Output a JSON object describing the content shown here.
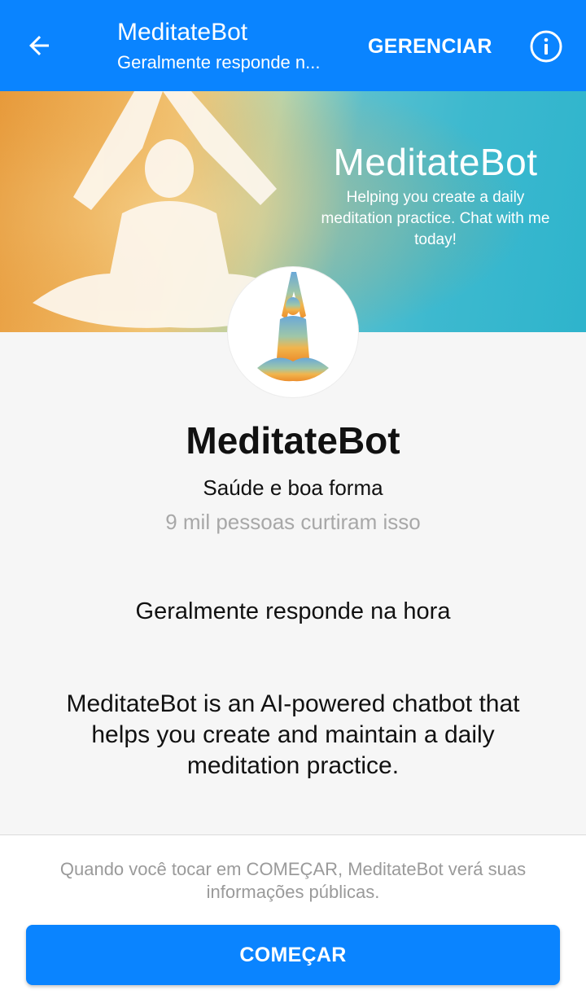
{
  "header": {
    "title": "MeditateBot",
    "subtitle": "Geralmente responde n...",
    "manage_label": "GERENCIAR",
    "back_icon": "arrow-left-icon",
    "info_icon": "info-icon"
  },
  "banner": {
    "title": "MeditateBot",
    "tagline": "Helping you create a daily meditation practice. Chat with me today!"
  },
  "profile": {
    "name": "MeditateBot",
    "category": "Saúde e boa forma",
    "likes": "9 mil pessoas curtiram isso",
    "response_time": "Geralmente responde na hora",
    "description": "MeditateBot is an AI-powered chatbot that helps you create and maintain a daily meditation practice."
  },
  "footer": {
    "disclaimer": "Quando você tocar em COMEÇAR, MeditateBot verá suas informações públicas.",
    "start_label": "COMEÇAR"
  },
  "colors": {
    "accent": "#0a84ff",
    "background": "#f6f6f6"
  }
}
